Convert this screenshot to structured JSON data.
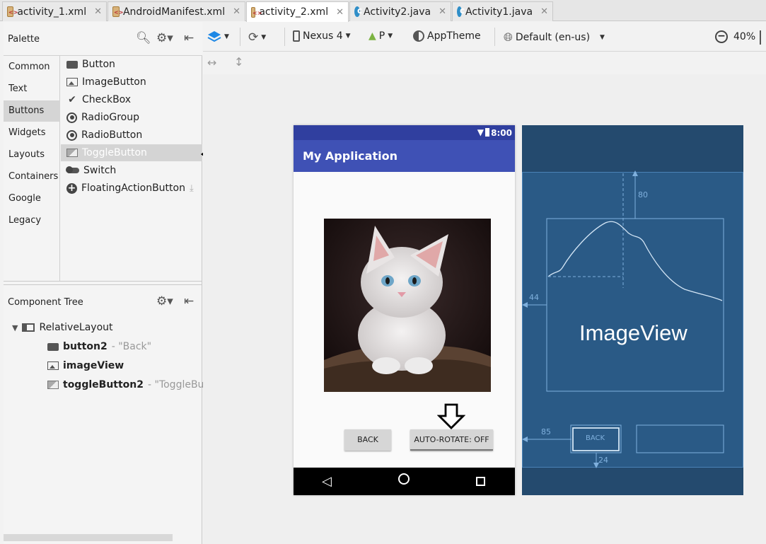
{
  "tabs": [
    {
      "label": "activity_1.xml",
      "type": "xml",
      "active": false
    },
    {
      "label": "AndroidManifest.xml",
      "type": "xml",
      "active": false
    },
    {
      "label": "activity_2.xml",
      "type": "xml",
      "active": true
    },
    {
      "label": "Activity2.java",
      "type": "java",
      "active": false
    },
    {
      "label": "Activity1.java",
      "type": "java",
      "active": false
    }
  ],
  "palette": {
    "title": "Palette",
    "categories": [
      "Common",
      "Text",
      "Buttons",
      "Widgets",
      "Layouts",
      "Containers",
      "Google",
      "Legacy"
    ],
    "selected_category": "Buttons",
    "items": [
      {
        "label": "Button",
        "icon": "button-icon"
      },
      {
        "label": "ImageButton",
        "icon": "image-button-icon"
      },
      {
        "label": "CheckBox",
        "icon": "check-icon"
      },
      {
        "label": "RadioGroup",
        "icon": "radio-icon"
      },
      {
        "label": "RadioButton",
        "icon": "radio-icon"
      },
      {
        "label": "ToggleButton",
        "icon": "toggle-icon"
      },
      {
        "label": "Switch",
        "icon": "switch-icon"
      },
      {
        "label": "FloatingActionButton",
        "icon": "fab-icon"
      }
    ],
    "selected_item": "ToggleButton"
  },
  "component_tree": {
    "title": "Component Tree",
    "root": "RelativeLayout",
    "children": [
      {
        "id": "button2",
        "hint": "- \"Back\""
      },
      {
        "id": "imageView",
        "hint": ""
      },
      {
        "id": "toggleButton2",
        "hint": "- \"ToggleButt"
      }
    ]
  },
  "toolbar": {
    "device": "Nexus 4",
    "api": "P",
    "theme": "AppTheme",
    "locale": "Default (en-us)",
    "zoom": "40%"
  },
  "preview": {
    "status_time": "8:00",
    "app_title": "My Application",
    "back_label": "BACK",
    "toggle_label": "AUTO-ROTATE: OFF"
  },
  "blueprint": {
    "imageview_label": "ImageView",
    "margin_top": "80",
    "margin_left_image": "44",
    "margin_left_button": "85",
    "margin_button_bottom": "24",
    "back_label": "BACK"
  },
  "colors": {
    "app_primary": "#3f51b5",
    "status_bar": "#303f9f",
    "blueprint_bg": "#244a6e"
  }
}
